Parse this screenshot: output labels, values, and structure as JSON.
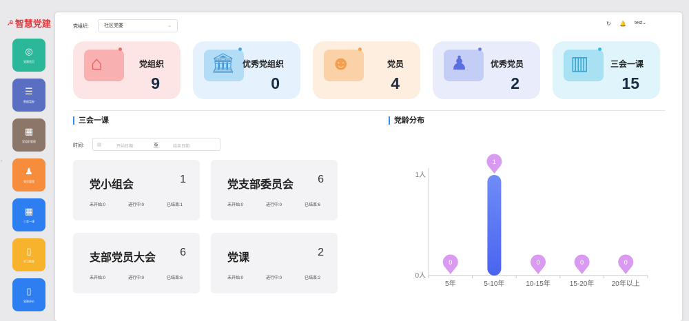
{
  "brand": {
    "flag_icon": "flag-icon",
    "name": "智慧党建"
  },
  "sidebar": {
    "items": [
      {
        "label": "党建首页",
        "icon": "compass-icon",
        "glyph": "◎",
        "color": "#2bb79a"
      },
      {
        "label": "数据看板",
        "icon": "database-icon",
        "glyph": "☰",
        "color": "#5a6fc2"
      },
      {
        "label": "党组织管理",
        "icon": "table-icon",
        "glyph": "▦",
        "color": "#8c7569"
      },
      {
        "label": "党员管理",
        "icon": "people-icon",
        "glyph": "♟",
        "color": "#f58d3d"
      },
      {
        "label": "三会一课",
        "icon": "grid-icon",
        "glyph": "▦",
        "color": "#2d7ef0"
      },
      {
        "label": "学习教育",
        "icon": "book-icon",
        "glyph": "▯",
        "color": "#f7b32b"
      },
      {
        "label": "党建评价",
        "icon": "book-open-icon",
        "glyph": "▯",
        "color": "#2d7ef0"
      }
    ]
  },
  "header": {
    "org_label": "党组织:",
    "org_value": "社区党委",
    "refresh_icon": "refresh-icon",
    "bell_icon": "bell-icon",
    "user": "test"
  },
  "stats": [
    {
      "title": "党组织",
      "value": "9",
      "icon": "house-icon",
      "glyph": "⌂",
      "bg": "#fde5e5",
      "blob": "#f8b0b0",
      "dot": "#e86a6a",
      "glyph_color": "#e35b5b"
    },
    {
      "title": "优秀党组织",
      "value": "0",
      "icon": "institution-icon",
      "glyph": "🏛",
      "bg": "#e5f2fd",
      "blob": "#b3dcf6",
      "dot": "#4aa3e6",
      "glyph_color": "#3f9be0"
    },
    {
      "title": "党员",
      "value": "4",
      "icon": "group-icon",
      "glyph": "☻",
      "bg": "#fdeedf",
      "blob": "#fbd2a8",
      "dot": "#f2a052",
      "glyph_color": "#f0a050"
    },
    {
      "title": "优秀党员",
      "value": "2",
      "icon": "excellent-member-icon",
      "glyph": "♟",
      "bg": "#e8ecfb",
      "blob": "#c4cdf5",
      "dot": "#6d7fe3",
      "glyph_color": "#5c6fe0"
    },
    {
      "title": "三会一课",
      "value": "15",
      "icon": "open-book-icon",
      "glyph": "▥",
      "bg": "#dff4fb",
      "blob": "#a8e0f4",
      "dot": "#3cb7e3",
      "glyph_color": "#2aa9dc"
    }
  ],
  "sections": {
    "meetings": "三会一课",
    "age": "党龄分布"
  },
  "filter": {
    "label": "时间:",
    "start_placeholder": "开始日期",
    "separator": "至",
    "end_placeholder": "结束日期",
    "calendar_icon": "calendar-icon"
  },
  "meetings": [
    {
      "name": "党小组会",
      "count": "1",
      "not_started": "未开始:0",
      "in_progress": "进行中:0",
      "finished": "已结束:1"
    },
    {
      "name": "党支部委员会",
      "count": "6",
      "not_started": "未开始:0",
      "in_progress": "进行中:0",
      "finished": "已结束:6"
    },
    {
      "name": "支部党员大会",
      "count": "6",
      "not_started": "未开始:0",
      "in_progress": "进行中:0",
      "finished": "已结束:6"
    },
    {
      "name": "党课",
      "count": "2",
      "not_started": "未开始:0",
      "in_progress": "进行中:0",
      "finished": "已结束:2"
    }
  ],
  "chart_data": {
    "type": "bar",
    "categories": [
      "5年",
      "5-10年",
      "10-15年",
      "15-20年",
      "20年以上"
    ],
    "values": [
      0,
      1,
      0,
      0,
      0
    ],
    "y_ticks": [
      "0人",
      "1人"
    ],
    "ylim": [
      0,
      1
    ],
    "bar_color_top": "#6f8cf7",
    "bar_color_bottom": "#4a64f0",
    "pin_color": "#d99bf0",
    "grid": false
  }
}
